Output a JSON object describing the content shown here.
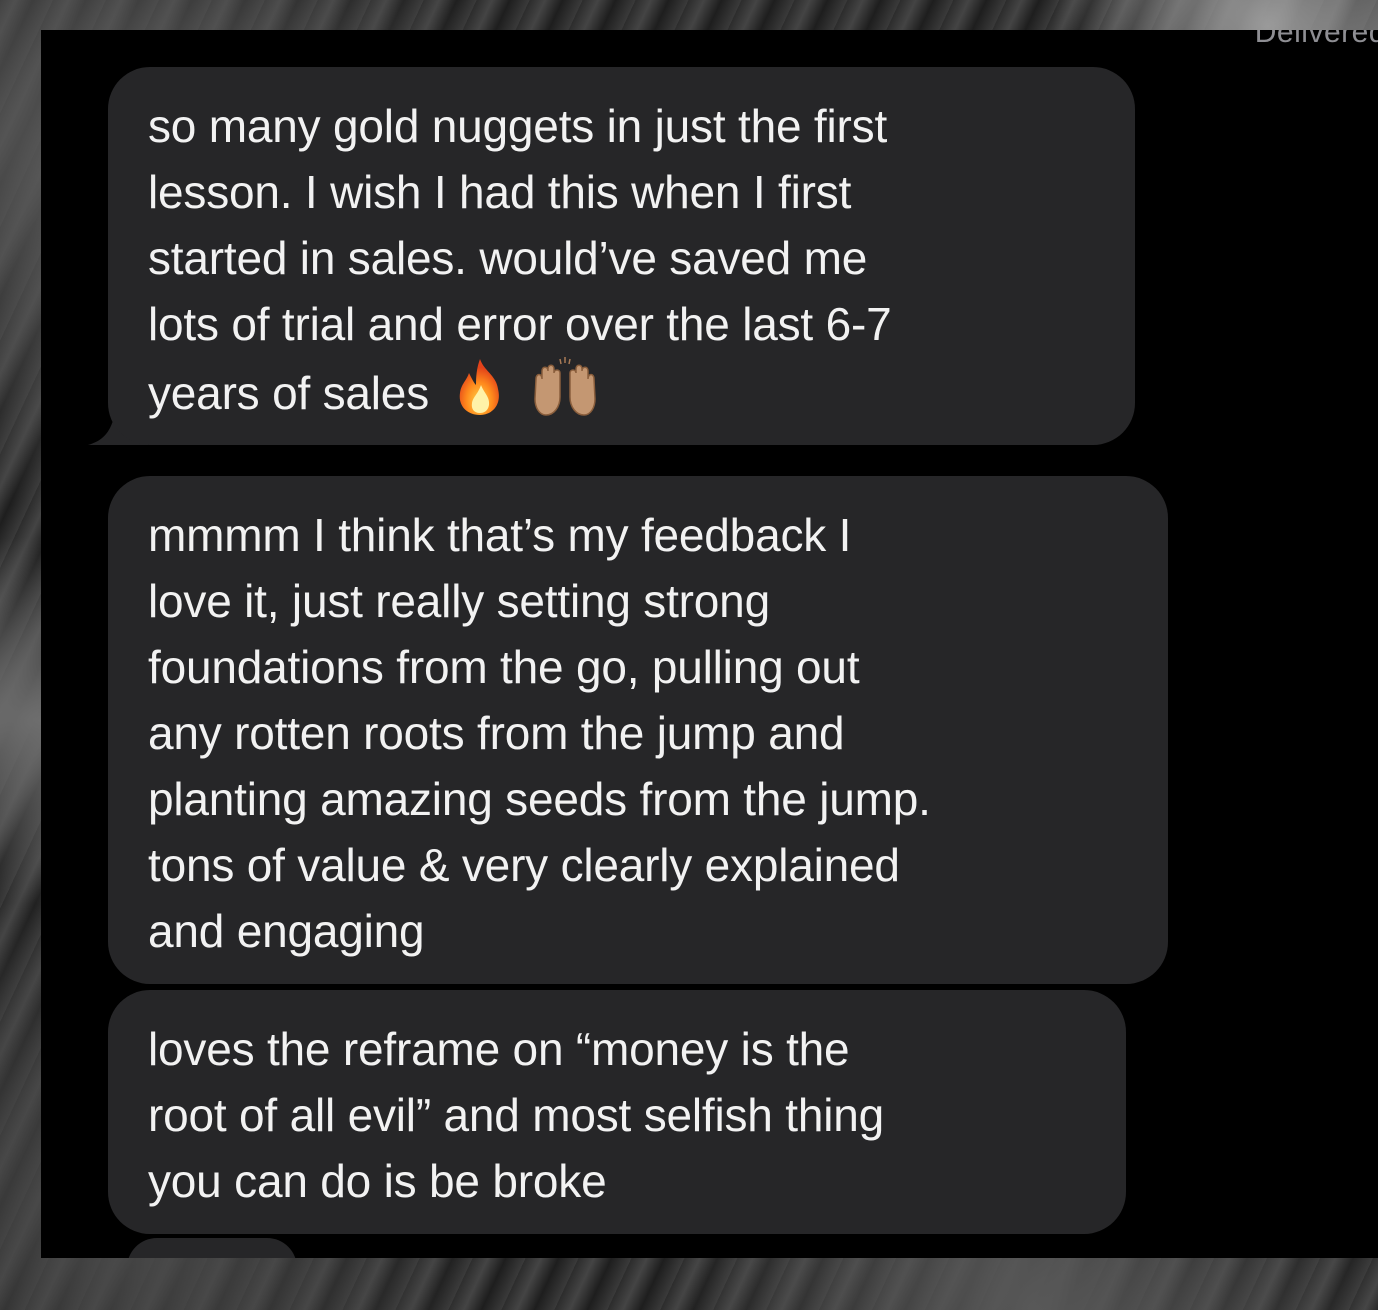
{
  "conversation": {
    "status_label": "Delivered",
    "messages": [
      {
        "text": "so many gold nuggets in just the first lesson. I wish I had this when I first started in sales. would’ve saved me lots of trial and error over the last 6-7 years of sales",
        "lines": [
          "so many gold nuggets in just the first",
          "lesson. I wish I had this when I first",
          "started in sales. would’ve saved me",
          "lots of trial and error over the last 6-7",
          "years of sales"
        ],
        "emoji": [
          "fire-emoji",
          "raising-hands-emoji"
        ]
      },
      {
        "text": "mmmm I think that’s my feedback I love it, just really setting strong foundations from the go, pulling out any rotten roots from the jump and planting amazing seeds from the jump. tons of value & very clearly explained and engaging",
        "lines": [
          "mmmm I think that’s my feedback I",
          "love it, just really setting strong",
          "foundations from the go, pulling out",
          "any rotten roots from the jump and",
          "planting amazing seeds from the jump.",
          "tons of value & very clearly explained",
          "and engaging"
        ]
      },
      {
        "text": "loves the reframe on “money is the root of all evil” and most selfish thing you can do is be broke",
        "lines": [
          "loves the reframe on “money is the",
          "root of all evil” and most selfish thing",
          "you can do is be broke"
        ]
      }
    ]
  },
  "colors": {
    "screen_background": "#000000",
    "bubble_background": "#262628",
    "bubble_text": "#f2f2f2",
    "status_text": "#8e8e93"
  }
}
